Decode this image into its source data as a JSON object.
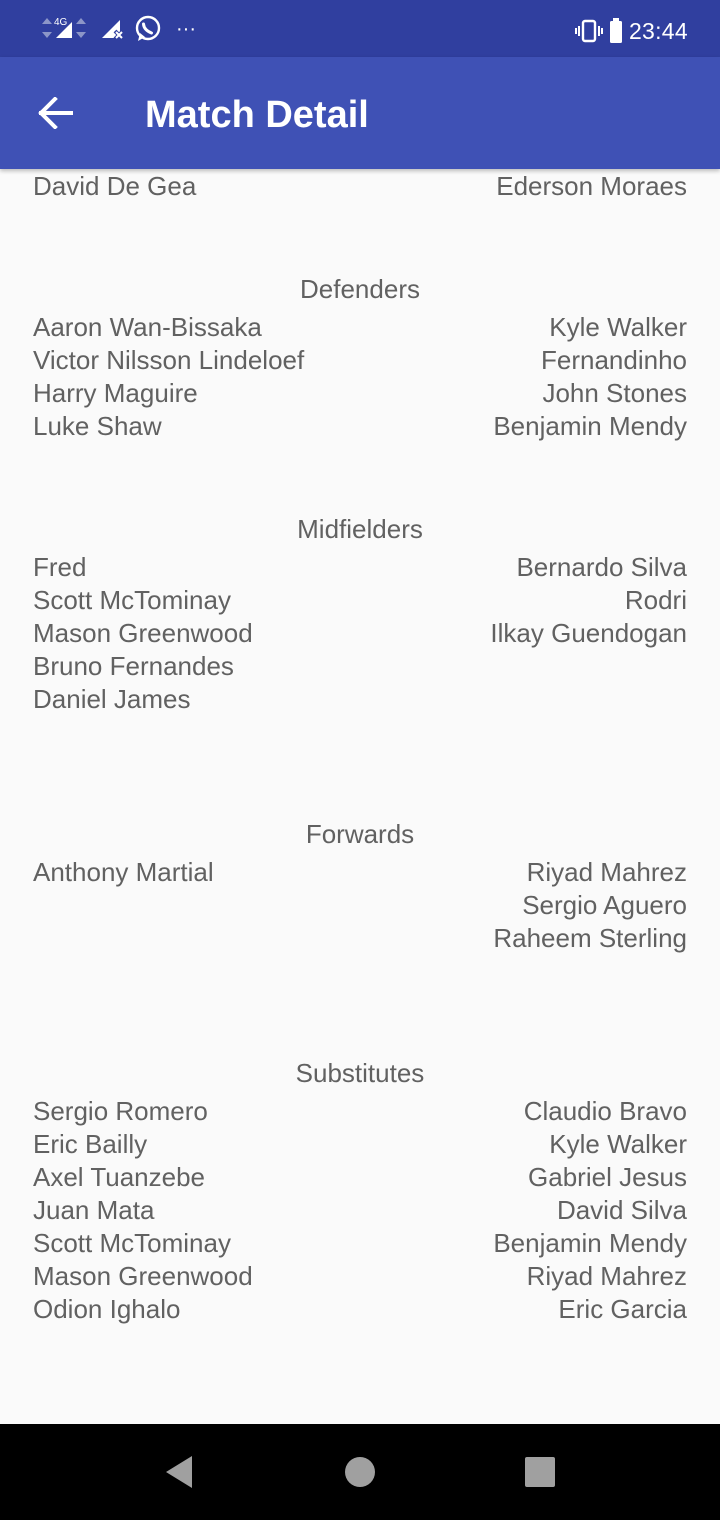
{
  "status_bar": {
    "network_label": "4G",
    "time": "23:44",
    "notification_more": "···"
  },
  "app_bar": {
    "title": "Match Detail"
  },
  "goalkeepers": {
    "home": [
      "David De Gea"
    ],
    "away": [
      "Ederson Moraes"
    ]
  },
  "sections": [
    {
      "heading": "Defenders",
      "home": [
        "Aaron Wan-Bissaka",
        "Victor Nilsson Lindeloef",
        "Harry Maguire",
        "Luke Shaw"
      ],
      "away": [
        "Kyle Walker",
        "Fernandinho",
        "John Stones",
        "Benjamin Mendy"
      ]
    },
    {
      "heading": "Midfielders",
      "home": [
        "Fred",
        "Scott McTominay",
        "Mason Greenwood",
        "Bruno Fernandes",
        "Daniel James"
      ],
      "away": [
        "Bernardo Silva",
        "Rodri",
        "Ilkay Guendogan"
      ]
    },
    {
      "heading": "Forwards",
      "home": [
        "Anthony Martial"
      ],
      "away": [
        "Riyad Mahrez",
        "Sergio Aguero",
        "Raheem Sterling"
      ]
    },
    {
      "heading": "Substitutes",
      "home": [
        "Sergio Romero",
        "Eric Bailly",
        "Axel Tuanzebe",
        "Juan Mata",
        "Scott McTominay",
        "Mason Greenwood",
        "Odion Ighalo"
      ],
      "away": [
        "Claudio Bravo",
        "Kyle Walker",
        "Gabriel Jesus",
        "David Silva",
        "Benjamin Mendy",
        "Riyad Mahrez",
        "Eric Garcia"
      ]
    }
  ],
  "colors": {
    "status_bar": "#303f9f",
    "app_bar": "#3f51b5",
    "background": "#fafafa",
    "text": "#616161"
  },
  "icons": {
    "back": "arrow-left-icon",
    "whatsapp": "whatsapp-icon",
    "vibrate": "vibrate-icon",
    "battery": "battery-icon"
  }
}
